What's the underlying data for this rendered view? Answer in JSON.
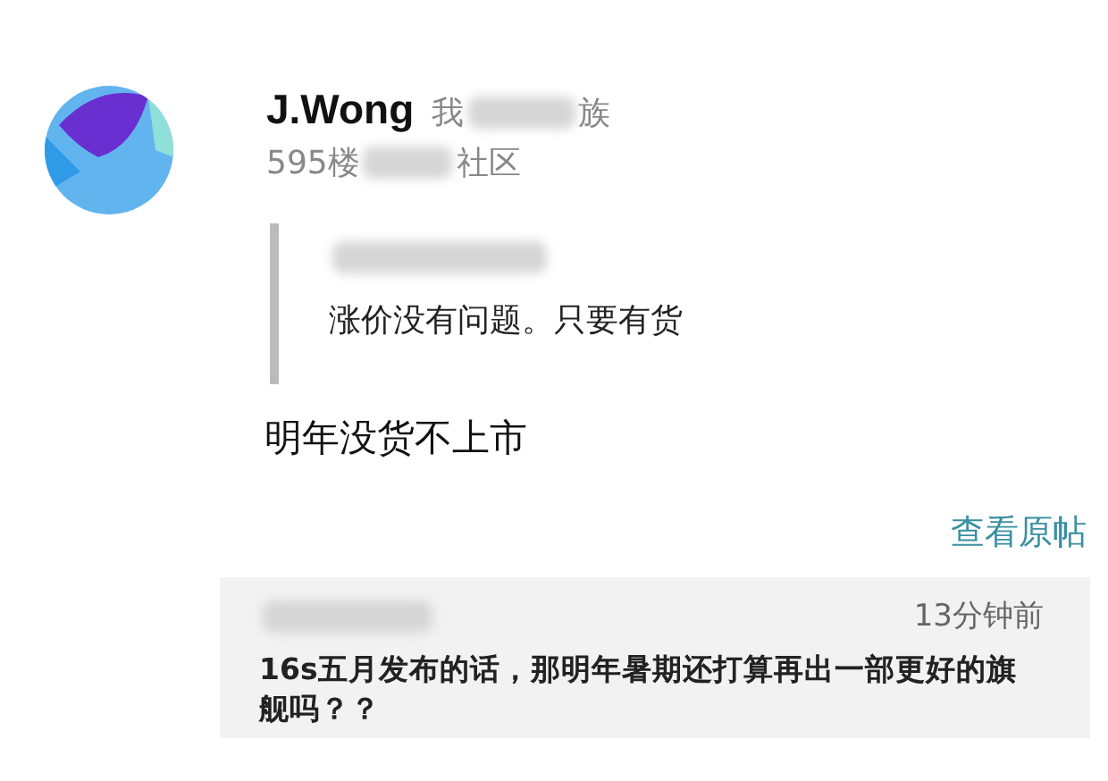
{
  "post": {
    "author": "J.Wong",
    "tag_parts": [
      "我",
      "族"
    ],
    "floor_parts": [
      "595楼",
      "社区"
    ],
    "quote": {
      "text": "涨价没有问题。只要有货"
    },
    "body": "明年没货不上市",
    "view_original": "查看原帖"
  },
  "reply": {
    "time": "13分钟前",
    "text": "16s五月发布的话，那明年暑期还打算再出一部更好的旗舰吗？？"
  }
}
